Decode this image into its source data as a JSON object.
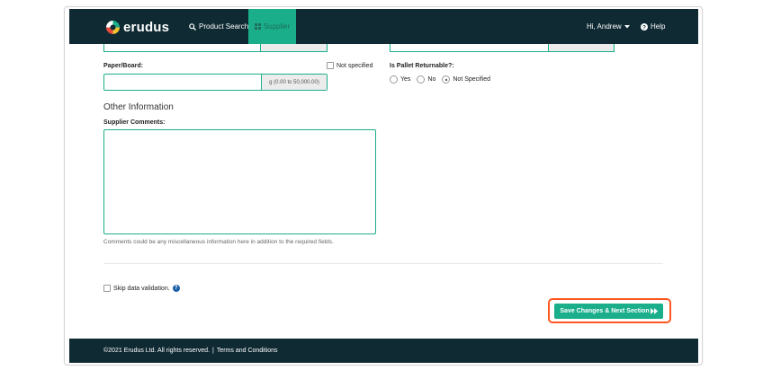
{
  "navbar": {
    "brand": "erudus",
    "product_search": "Product Search",
    "supplier": "Supplier",
    "user_greeting": "Hi, Andrew",
    "help": "Help"
  },
  "form": {
    "paper_board_label": "Paper/Board:",
    "not_specified_checkbox": "Not specified",
    "paper_board_unit": "g (0.00 to 50,000.00)",
    "pallet_label": "Is Pallet Returnable?:",
    "pallet_options": [
      "Yes",
      "No",
      "Not Specified"
    ],
    "pallet_selected": "Not Specified",
    "other_info_title": "Other Information",
    "supplier_comments_label": "Supplier Comments:",
    "supplier_comments_value": "",
    "supplier_comments_help": "Comments could be any miscellaneous information here in addition to the required fields.",
    "skip_validation_label": "Skip data validation.",
    "save_button": "Save Changes & Next Section"
  },
  "footer": {
    "copyright": "©2021 Erudus Ltd. All rights reserved.",
    "separator": "|",
    "terms": "Terms and Conditions"
  },
  "colors": {
    "navbar_bg": "#0f2a33",
    "accent": "#1aae8a",
    "highlight": "#ff5722"
  }
}
